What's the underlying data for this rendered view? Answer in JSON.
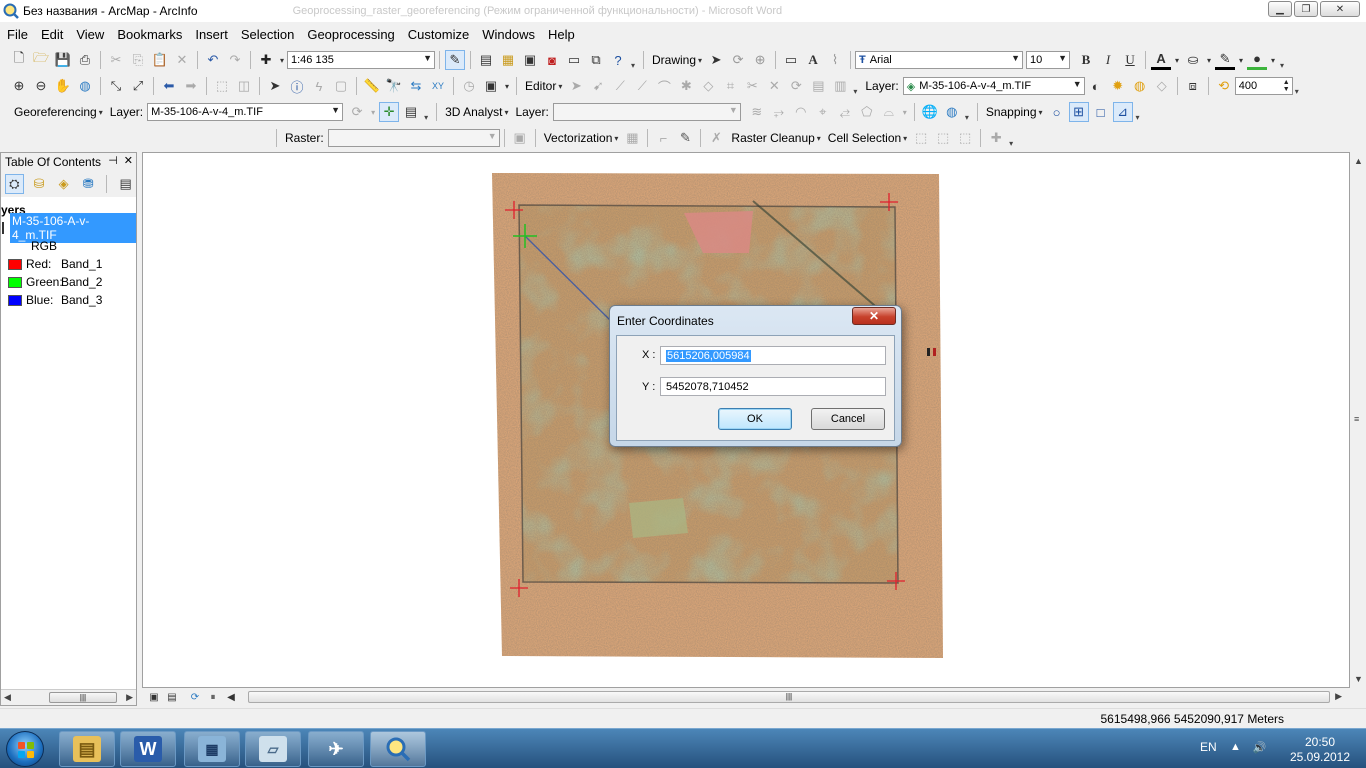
{
  "window": {
    "title": "Без названия - ArcMap - ArcInfo",
    "ghost_title": "Geoprocessing_raster_georeferencing (Режим ограниченной функциональности) - Microsoft Word",
    "minimize": "▁",
    "maximize": "❐",
    "close": "✕"
  },
  "menu": [
    "File",
    "Edit",
    "View",
    "Bookmarks",
    "Insert",
    "Selection",
    "Geoprocessing",
    "Customize",
    "Windows",
    "Help"
  ],
  "standard_toolbar": {
    "scale": "1:46 135",
    "drawing_label": "Drawing",
    "font_name": "Arial",
    "font_size": "10",
    "bold": "B",
    "italic": "I",
    "underline": "U",
    "font_color_glyph": "A"
  },
  "tools_toolbar": {
    "editor_label": "Editor",
    "layer_label": "Layer:",
    "layer_value": "M-35-106-A-v-4_m.TIF",
    "display_value": "400"
  },
  "georef_toolbar": {
    "georeferencing_label": "Georeferencing",
    "layer_label": "Layer:",
    "layer_value": "M-35-106-A-v-4_m.TIF",
    "analyst_label": "3D Analyst",
    "analyst_layer_label": "Layer:",
    "snapping_label": "Snapping"
  },
  "raster_toolbar": {
    "raster_label": "Raster:",
    "vectorization_label": "Vectorization",
    "raster_cleanup_label": "Raster Cleanup",
    "cell_selection_label": "Cell Selection"
  },
  "toc": {
    "title": "Table Of Contents",
    "pin": "⊣",
    "close": "✕",
    "layers_title": "yers",
    "layer_name": "M-35-106-A-v-4_m.TIF",
    "rgb_label": "RGB",
    "bands": [
      {
        "channel": "Red:",
        "band": "Band_1",
        "color": "#ff0000"
      },
      {
        "channel": "Green:",
        "band": "Band_2",
        "color": "#00ff00"
      },
      {
        "channel": "Blue:",
        "band": "Band_3",
        "color": "#0000ff"
      }
    ]
  },
  "dialog": {
    "title": "Enter Coordinates",
    "close_glyph": "✕",
    "x_label": "X :",
    "x_value": "5615206,005984",
    "y_label": "Y :",
    "y_value": "5452078,710452",
    "ok_label": "OK",
    "cancel_label": "Cancel"
  },
  "status": {
    "coords": "5615498,966  5452090,917 Meters"
  },
  "taskbar": {
    "lang": "EN",
    "time": "20:50",
    "date": "25.09.2012"
  },
  "colors": {
    "selection_blue": "#3399ff",
    "link_line": "#4b5f9e",
    "control_point": "#e0202e"
  }
}
